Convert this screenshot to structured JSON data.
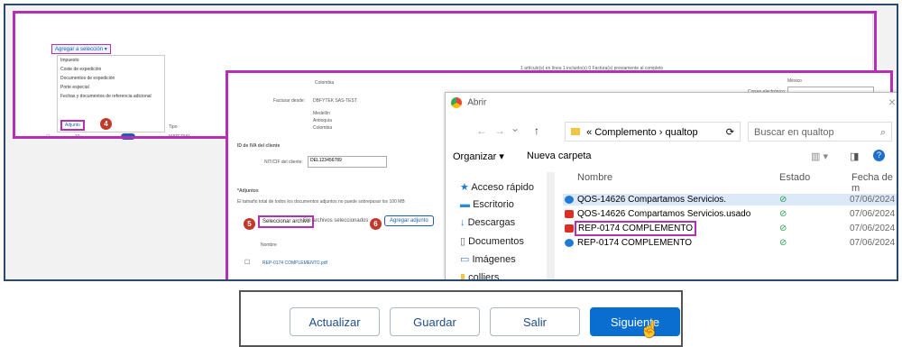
{
  "back_panel": {
    "add_button": "Agregar a selección ▾",
    "menu_items": [
      "Impuesto",
      "Coste de expedición",
      "Documentos de expedición",
      "Porte especial",
      "Fechas y documentos de referencia adicional"
    ],
    "adjunto_label": "Adjunto",
    "row_label": "MATERIAL",
    "row_num": "10",
    "header_right": "1 artículo(s) en línea  1 incluido(s)  0 Factura(s) previamente al completo",
    "col_tipo": "Tipo",
    "badge": "4"
  },
  "form_panel": {
    "colombia_top": "Colombia",
    "facturar_label": "Facturar desde:",
    "facturar_value": "DBFYTEK SAS-TEST",
    "address_lines": [
      "Medellín",
      "Antioquia",
      "Colombia"
    ],
    "id_label": "ID de IVA del cliente",
    "nit_label": "NIT/CIF del cliente:",
    "nit_value": "DEL123456789",
    "adjuntos_label": "*Adjuntos",
    "size_note": "El tamaño total de todos los documentos adjuntos no puede sobrepasar los 100 MB",
    "select_btn": "Seleccionar archivo",
    "no_file": "Sin archivos seleccionados",
    "add_adj_btn": "Agregar adjunto",
    "nombre_col": "Nombre",
    "file_row": "REP-0174 COMPLEMENTO.pdf",
    "mexico": "México",
    "correo_label": "Correo electrónico:",
    "badge5": "5",
    "badge6": "6"
  },
  "dialog": {
    "title": "Abrir",
    "close": "×",
    "nav_back": "←",
    "nav_fwd": "→",
    "nav_down": "⌄",
    "nav_up": "↑",
    "path": "« Complemento › qualtop",
    "refresh": "⟳",
    "search_placeholder": "Buscar en qualtop",
    "organize": "Organizar ▾",
    "new_folder": "Nueva carpeta",
    "sidebar": [
      "Acceso rápido",
      "Escritorio",
      "Descargas",
      "Documentos",
      "Imágenes",
      "colliers"
    ],
    "columns": {
      "name": "Nombre",
      "status": "Estado",
      "date": "Fecha de m"
    },
    "files": [
      {
        "name": "QOS-14626 Compartamos Servicios.",
        "status": "⊘",
        "date": "07/06/2024",
        "icon": "edge",
        "color": "#1f7bd6"
      },
      {
        "name": "QOS-14626 Compartamos Servicios.usado",
        "status": "⊘",
        "date": "07/06/2024",
        "icon": "pdf",
        "color": "#d93025"
      },
      {
        "name": "REP-0174 COMPLEMENTO",
        "status": "⊘",
        "date": "07/06/2024",
        "icon": "pdf",
        "color": "#d93025"
      },
      {
        "name": "REP-0174 COMPLEMENTO",
        "status": "⊘",
        "date": "07/06/2024",
        "icon": "edge",
        "color": "#1f7bd6"
      }
    ]
  },
  "buttons": [
    "Actualizar",
    "Guardar",
    "Salir",
    "Siguiente"
  ],
  "colors": {
    "highlight": "#b42fb4",
    "primary": "#0a6ed1",
    "badge": "#c0392b"
  }
}
